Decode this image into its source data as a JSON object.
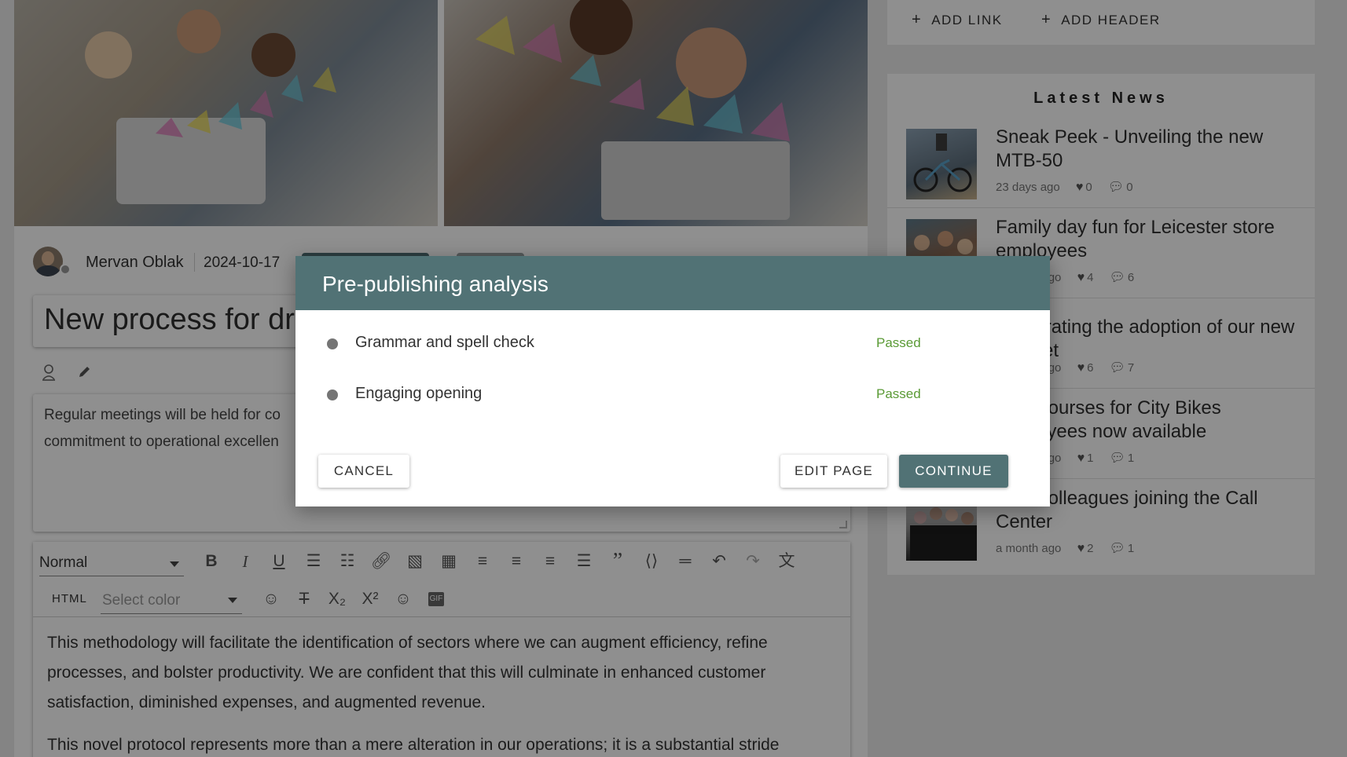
{
  "article": {
    "author": "Mervan Oblak",
    "date": "2024-10-17",
    "title": "New process for dri",
    "summary_lines": [
      "Regular meetings will be held for co",
      "commitment to operational excellen"
    ],
    "paragraphs": [
      "This methodology will facilitate the identification of sectors where we can augment efficiency, refine",
      "processes, and bolster productivity. We are confident that this will culminate in enhanced customer",
      "satisfaction, diminished expenses, and augmented revenue.",
      "This novel protocol represents more than a mere alteration in our operations; it is a substantial stride"
    ]
  },
  "editor": {
    "format_value": "Normal",
    "html_label": "HTML",
    "color_placeholder": "Select color"
  },
  "sidebar": {
    "add_link": "ADD LINK",
    "add_header": "ADD HEADER",
    "news_title": "Latest News",
    "news": [
      {
        "headline": "Sneak Peek - Unveiling the new MTB-50",
        "age": "23 days ago",
        "likes": "0",
        "comments": "0"
      },
      {
        "headline": "Family day fun for Leicester store employees",
        "age": "a month ago",
        "likes": "4",
        "comments": "6"
      },
      {
        "headline": "Celebrating the adoption of our new intranet",
        "age": "a month ago",
        "likes": "6",
        "comments": "7"
      },
      {
        "headline": "New courses for City Bikes employees now available",
        "age": "a month ago",
        "likes": "1",
        "comments": "1"
      },
      {
        "headline": "New colleagues joining the Call Center",
        "age": "a month ago",
        "likes": "2",
        "comments": "1"
      }
    ]
  },
  "dialog": {
    "title": "Pre-publishing analysis",
    "checks": [
      {
        "label": "Grammar and spell check",
        "status": "Passed"
      },
      {
        "label": "Engaging opening",
        "status": "Passed"
      }
    ],
    "cancel": "CANCEL",
    "edit_page": "EDIT PAGE",
    "continue": "CONTINUE"
  },
  "colors": {
    "primary": "#517275",
    "passed": "#5a9a35",
    "overlay": "rgba(0,0,0,0.44)"
  },
  "icons": [
    "plus-icon",
    "heart-icon",
    "comment-icon",
    "bold-icon",
    "italic-icon",
    "underline-icon",
    "bullet-list-icon",
    "numbered-list-icon",
    "link-icon",
    "image-icon",
    "table-icon",
    "align-left-icon",
    "align-center-icon",
    "align-right-icon",
    "justify-icon",
    "quote-icon",
    "code-block-icon",
    "horizontal-rule-icon",
    "undo-icon",
    "redo-icon",
    "translate-icon",
    "strikethrough-icon",
    "subscript-icon",
    "superscript-icon",
    "emoji-icon",
    "gif-icon",
    "edit-icon"
  ]
}
